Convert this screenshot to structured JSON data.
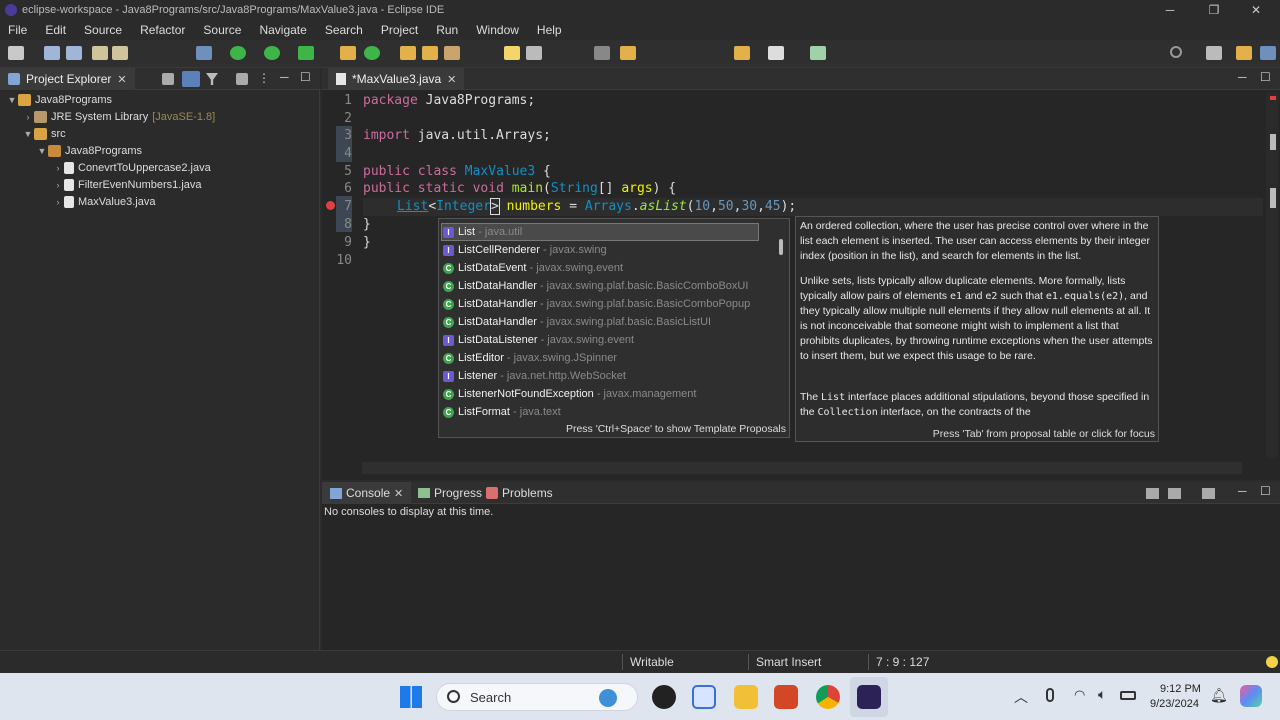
{
  "window": {
    "title": "eclipse-workspace - Java8Programs/src/Java8Programs/MaxValue3.java - Eclipse IDE"
  },
  "menu": [
    "File",
    "Edit",
    "Source",
    "Refactor",
    "Source",
    "Navigate",
    "Search",
    "Project",
    "Run",
    "Window",
    "Help"
  ],
  "project_explorer": {
    "tab_label": "Project Explorer",
    "tree": [
      {
        "label": "Java8Programs",
        "suffix": ""
      },
      {
        "label": "JRE System Library",
        "suffix": "[JavaSE-1.8]"
      },
      {
        "label": "src",
        "suffix": ""
      },
      {
        "label": "Java8Programs",
        "suffix": ""
      },
      {
        "label": "ConevrtToUppercase2.java",
        "suffix": ""
      },
      {
        "label": "FilterEvenNumbers1.java",
        "suffix": ""
      },
      {
        "label": "MaxValue3.java",
        "suffix": ""
      }
    ]
  },
  "editor": {
    "tab_label": "*MaxValue3.java",
    "line_numbers": [
      "1",
      "2",
      "3",
      "4",
      "5",
      "6",
      "7",
      "8",
      "9",
      "10"
    ],
    "code": {
      "l1_kw": "package",
      "l1_rest": " Java8Programs;",
      "l3_kw": "import",
      "l3_rest": " java.util.Arrays;",
      "l5_kw1": "public",
      "l5_kw2": " class",
      "l5_cls": " MaxValue3",
      "l5_rest": " {",
      "l6_kw1": "public",
      "l6_kw2": " static",
      "l6_kw3": " void",
      "l6_mth": " main",
      "l6_p1": "(",
      "l6_cls": "String",
      "l6_p2": "[] ",
      "l6_var": "args",
      "l6_rest": ") {",
      "l7_cls1": "List",
      "l7_lt": "<",
      "l7_cls2": "Integer",
      "l7_gt": ">",
      "l7_var": " numbers",
      "l7_eq": " = ",
      "l7_cls3": "Arrays",
      "l7_dot": ".",
      "l7_stat": "asList",
      "l7_args": "(",
      "l7_n1": "10",
      "l7_c1": ",",
      "l7_n2": "50",
      "l7_c2": ",",
      "l7_n3": "30",
      "l7_c3": ",",
      "l7_n4": "45",
      "l7_end": ");",
      "l8": "}",
      "l9": "}"
    }
  },
  "completion": {
    "proposals": [
      {
        "type": "interface",
        "name": "List",
        "package": "- java.util"
      },
      {
        "type": "interface",
        "name": "ListCellRenderer",
        "package": "- javax.swing"
      },
      {
        "type": "class",
        "name": "ListDataEvent",
        "package": "- javax.swing.event"
      },
      {
        "type": "class",
        "name": "ListDataHandler",
        "package": "- javax.swing.plaf.basic.BasicComboBoxUI"
      },
      {
        "type": "class",
        "name": "ListDataHandler",
        "package": "- javax.swing.plaf.basic.BasicComboPopup"
      },
      {
        "type": "class",
        "name": "ListDataHandler",
        "package": "- javax.swing.plaf.basic.BasicListUI"
      },
      {
        "type": "interface",
        "name": "ListDataListener",
        "package": "- javax.swing.event"
      },
      {
        "type": "class",
        "name": "ListEditor",
        "package": "- javax.swing.JSpinner"
      },
      {
        "type": "interface",
        "name": "Listener",
        "package": "- java.net.http.WebSocket"
      },
      {
        "type": "class",
        "name": "ListenerNotFoundException",
        "package": "- javax.management"
      },
      {
        "type": "class",
        "name": "ListFormat",
        "package": "- java.text"
      }
    ],
    "status": "Press 'Ctrl+Space' to show Template Proposals"
  },
  "doc": {
    "p1": "An ordered collection, where the user has precise control over where in the list each element is inserted. The user can access elements by their integer index (position in the list), and search for elements in the list.",
    "p2a": "Unlike sets, lists typically allow duplicate elements. More formally, lists typically allow pairs of elements ",
    "p2_e1": "e1",
    "p2b": " and ",
    "p2_e2": "e2",
    "p2c": " such that ",
    "p2_eq": "e1.equals(e2)",
    "p2d": ", and they typically allow multiple null elements if they allow null elements at all. It is not inconceivable that someone might wish to implement a list that prohibits duplicates, by throwing runtime exceptions when the user attempts to insert them, but we expect this usage to be rare.",
    "p3a": "The ",
    "p3_list": "List",
    "p3b": " interface places additional stipulations, beyond those specified in the ",
    "p3_coll": "Collection",
    "p3c": " interface, on the contracts of the",
    "status": "Press 'Tab' from proposal table or click for focus"
  },
  "console": {
    "tabs": [
      "Console",
      "Progress",
      "Problems"
    ],
    "message": "No consoles to display at this time."
  },
  "status_bar": {
    "mode": "Writable",
    "insert": "Smart Insert",
    "position": "7 : 9 : 127"
  },
  "taskbar": {
    "search_label": "Search",
    "time": "9:12 PM",
    "date": "9/23/2024"
  },
  "colors": {
    "keyword": "#cc6c9c",
    "type": "#1290c3",
    "method": "#a7ec21",
    "variable": "#f2f200"
  }
}
